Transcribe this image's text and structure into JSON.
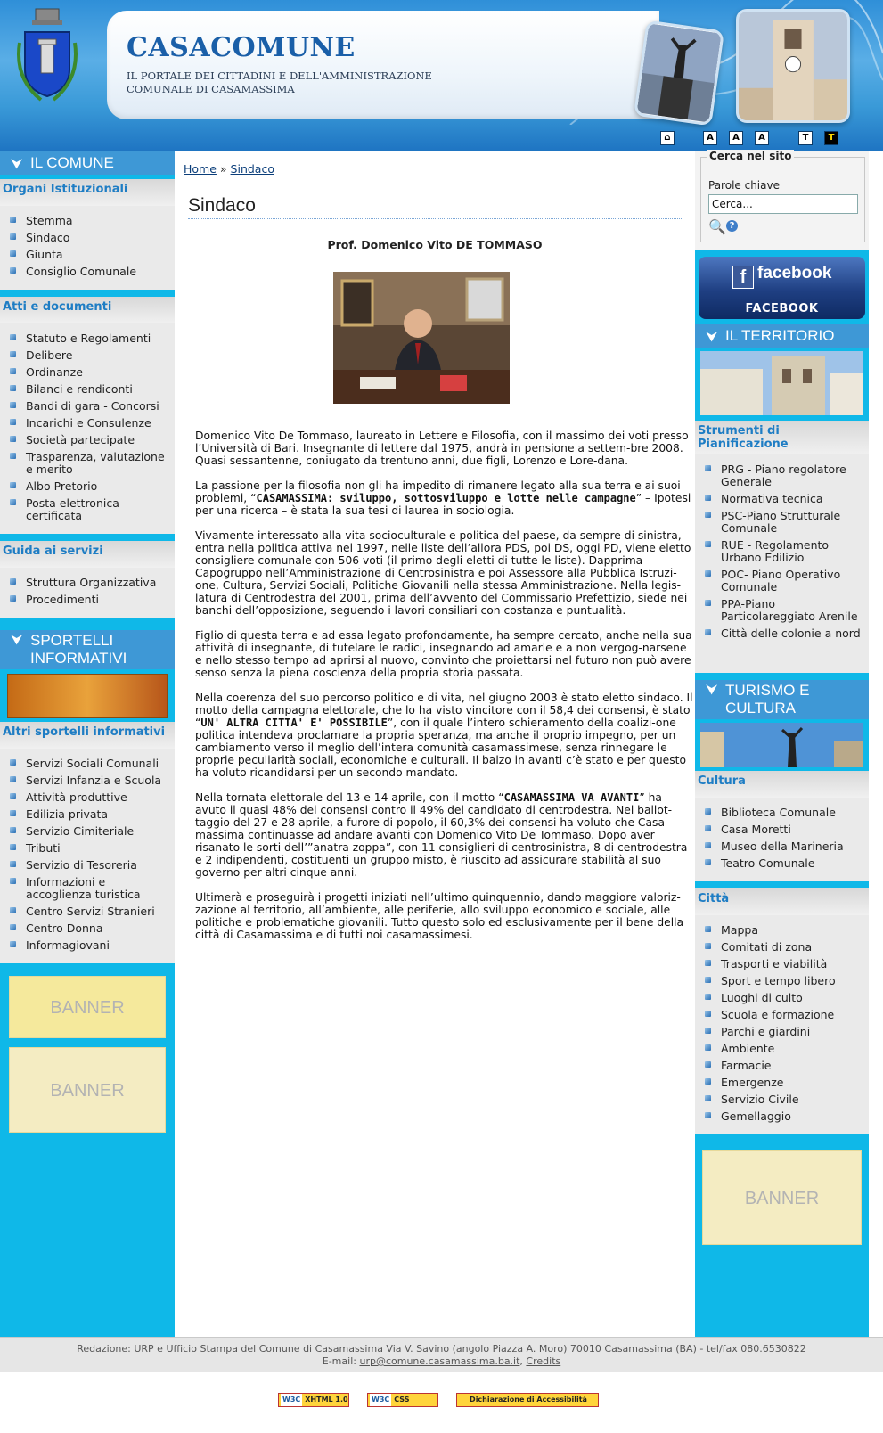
{
  "header": {
    "site_name": "CASACOMUNE",
    "subtitle_line1": "Il portale dei cittadini e dell'Amministrazione",
    "subtitle_line2": "Comunale di Casamassima",
    "toolbar": {
      "home": "",
      "font_smaller": "A",
      "font_normal": "A",
      "font_larger": "A",
      "text_only": "T",
      "high_contrast": "T"
    }
  },
  "left": {
    "il_comune_heading": "IL COMUNE",
    "organi": {
      "title": "Organi Istituzionali",
      "items": [
        "Stemma",
        "Sindaco",
        "Giunta",
        "Consiglio Comunale"
      ]
    },
    "atti": {
      "title": "Atti e documenti",
      "items": [
        "Statuto e Regolamenti",
        "Delibere",
        "Ordinanze",
        "Bilanci e rendiconti",
        "Bandi di gara - Concorsi",
        "Incarichi e Consulenze",
        "Società partecipate",
        "Trasparenza, valutazione e merito",
        "Albo Pretorio",
        "Posta elettronica certificata"
      ]
    },
    "guida": {
      "title": "Guida ai servizi",
      "items": [
        "Struttura Organizzativa",
        "Procedimenti"
      ]
    },
    "sportelli_heading_line1": "SPORTELLI",
    "sportelli_heading_line2": "INFORMATIVI",
    "altri": {
      "title": "Altri sportelli informativi",
      "items": [
        "Servizi Sociali Comunali",
        "Servizi Infanzia e Scuola",
        "Attività produttive",
        "Edilizia privata",
        "Servizio Cimiteriale",
        "Tributi",
        "Servizio di Tesoreria",
        "Informazioni e accoglienza turistica",
        "Centro Servizi Stranieri",
        "Centro Donna",
        "Informagiovani"
      ]
    },
    "banner1": "BANNER",
    "banner2": "BANNER"
  },
  "main": {
    "breadcrumb_home": "Home",
    "breadcrumb_sep": "»",
    "breadcrumb_current": "Sindaco",
    "title": "Sindaco",
    "mayor_name": "Prof. Domenico Vito DE TOMMASO",
    "paragraphs": [
      "Domenico Vito De Tommaso, laureato in Lettere e Filosofia, con il massimo dei voti presso l’Università di Bari. Insegnante di lettere dal 1975, andrà in pensione a settem-bre 2008. Quasi sessantenne, coniugato  da trentuno anni, due figli, Lorenzo e Lore-dana.",
      "Vivamente interessato alla vita socioculturale e politica del paese, da sempre di sinistra, entra nella politica attiva nel 1997, nelle liste dell’allora PDS, poi DS, oggi  PD, viene eletto consigliere comunale con 506 voti (il primo degli eletti di tutte le liste). Dapprima Capogruppo nell’Amministrazione di Centrosinistra e poi Assessore alla Pubblica Istruzi-one, Cultura, Servizi Sociali, Politiche Giovanili nella stessa Amministrazione. Nella  legis-latura di Centrodestra del 2001, prima dell’avvento del Commissario Prefettizio, siede nei banchi dell’opposizione, seguendo i lavori consiliari con costanza e puntualità.",
      "Figlio di questa terra e ad essa legato profondamente, ha sempre cercato, anche nella sua attività di insegnante, di tutelare le radici, insegnando ad amarle e a non vergog-narsene e nello stesso tempo ad aprirsi al nuovo, convinto che proiettarsi nel futuro non può avere senso senza la piena coscienza della propria storia passata.",
      "Ultimerà e proseguirà i progetti iniziati nell’ultimo quinquennio, dando maggiore valoriz-zazione al territorio, all’ambiente, alle periferie, allo sviluppo economico e sociale, alle politiche e problematiche giovanili. Tutto questo solo ed esclusivamente per il bene della città di Casamassima e di tutti noi casamassimesi."
    ],
    "p2_start": "La passione per la filosofia  non gli ha impedito di rimanere legato alla sua terra e ai suoi problemi, “",
    "p2_bold": "CASAMASSIMA: sviluppo, sottosviluppo e lotte nelle campagne",
    "p2_end": "” – Ipotesi per una ricerca – è stata la sua tesi di laurea in sociologia.",
    "p5_start": "Nella coerenza del suo percorso politico e di vita, nel giugno 2003 è stato eletto sindaco. Il motto della campagna elettorale, che lo ha visto vincitore con il 58,4 dei consensi, è stato “",
    "p5_bold": "UN' ALTRA CITTA' E' POSSIBILE",
    "p5_end": "”, con il quale l’intero schieramento della coalizi-one politica intendeva proclamare la propria speranza, ma anche il proprio impegno, per un cambiamento verso il meglio dell’intera comunità casamassimese, senza rinnegare le proprie peculiarità sociali, economiche e culturali. Il balzo in avanti c’è stato e per questo ha voluto ricandidarsi per un secondo mandato.",
    "p6_start": "Nella tornata elettorale del 13 e 14 aprile, con il motto  “",
    "p6_bold": "CASAMASSIMA VA AVANTI",
    "p6_end": "” ha avuto il quasi 48% dei consensi contro il 49% del candidato di centrodestra. Nel ballot-taggio del 27 e 28 aprile, a furore di popolo, il 60,3% dei consensi ha voluto che Casa-massima continuasse ad andare avanti con Domenico Vito De Tommaso. Dopo aver risanato le sorti dell’”anatra zoppa”, con 11 consiglieri di centrosinistra, 8 di centrodestra e 2 indipendenti, costituenti un gruppo misto, è riuscito ad assicurare stabilità al suo governo per altri cinque anni."
  },
  "right": {
    "search": {
      "legend": "Cerca nel sito",
      "label": "Parole chiave",
      "value": "Cerca..."
    },
    "facebook_word": "facebook",
    "facebook_caption": "FACEBOOK",
    "territorio_heading": "IL TERRITORIO",
    "strumenti": {
      "title": "Strumenti di Pianificazione",
      "items": [
        "PRG - Piano regolatore Generale",
        "Normativa tecnica",
        "PSC-Piano Strutturale Comunale",
        "RUE - Regolamento Urbano Edilizio",
        "POC- Piano Operativo Comunale",
        "PPA-Piano Particolareggiato Arenile",
        "Città delle colonie a nord"
      ]
    },
    "turismo_line1": "TURISMO E",
    "turismo_line2": "CULTURA",
    "cultura": {
      "title": "Cultura",
      "items": [
        "Biblioteca Comunale",
        "Casa Moretti",
        "Museo della Marineria",
        "Teatro Comunale"
      ]
    },
    "citta": {
      "title": "Città",
      "items": [
        "Mappa",
        "Comitati di zona",
        "Trasporti e viabilità",
        "Sport e tempo libero",
        "Luoghi di culto",
        "Scuola e formazione",
        "Parchi e giardini",
        "Ambiente",
        "Farmacie",
        "Emergenze",
        "Servizio Civile",
        "Gemellaggio"
      ]
    },
    "banner": "BANNER"
  },
  "footer": {
    "line1": "Redazione: URP e Ufficio Stampa del Comune di Casamassima Via V. Savino (angolo Piazza A. Moro)  70010 Casamassima (BA) - tel/fax 080.6530822",
    "email_label": "E-mail:",
    "email": "urp@comune.casamassima.ba.it",
    "credits": "Credits",
    "badge_xhtml": "XHTML 1.0",
    "badge_css": "CSS",
    "badge_access": "Dichiarazione di Accessibilità",
    "w3c": "W3C"
  }
}
